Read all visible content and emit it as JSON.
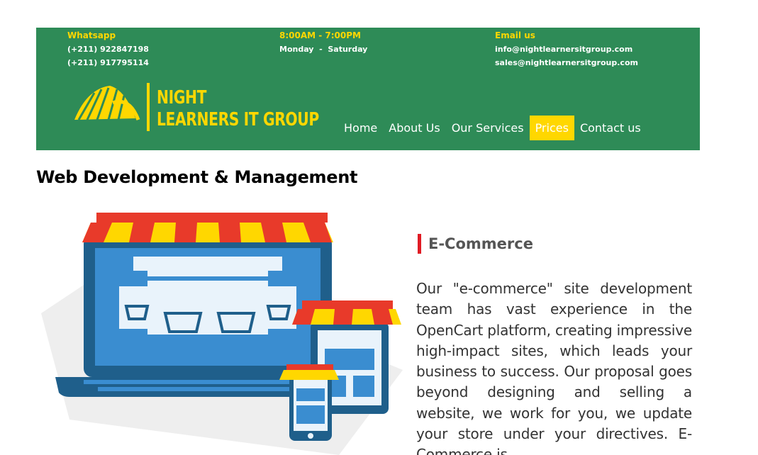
{
  "header": {
    "whatsapp": {
      "label": "Whatsapp",
      "phone1": "(+211) 922847198",
      "phone2": "(+211) 917795114"
    },
    "hours": {
      "time": "8:00AM - 7:00PM",
      "days": "Monday  -  Saturday"
    },
    "email": {
      "label": "Email us",
      "email1": "info@nightlearnersitgroup.com",
      "email2": "sales@nightlearnersitgroup.com"
    },
    "logo": {
      "line1": "NIGHT",
      "line2": "LEARNERS IT GROUP"
    },
    "nav": [
      {
        "label": "Home"
      },
      {
        "label": "About Us"
      },
      {
        "label": "Our Services"
      },
      {
        "label": "Prices",
        "active": true
      },
      {
        "label": "Contact us"
      }
    ],
    "colors": {
      "banner": "#2e8b57",
      "accent": "#ffd700"
    }
  },
  "page_title": "Web Development & Management",
  "section": {
    "heading": "E-Commerce",
    "body": "Our \"e-commerce\" site development team has vast experience in the OpenCart platform, creating impressive high-impact sites, which leads your business to success. Our proposal goes beyond designing and selling a website, we work for you, we update your store under your directives. E-Commerce is",
    "accent_color": "#e01b24"
  },
  "illustration": {
    "icon": "online-shop-devices-icon"
  }
}
